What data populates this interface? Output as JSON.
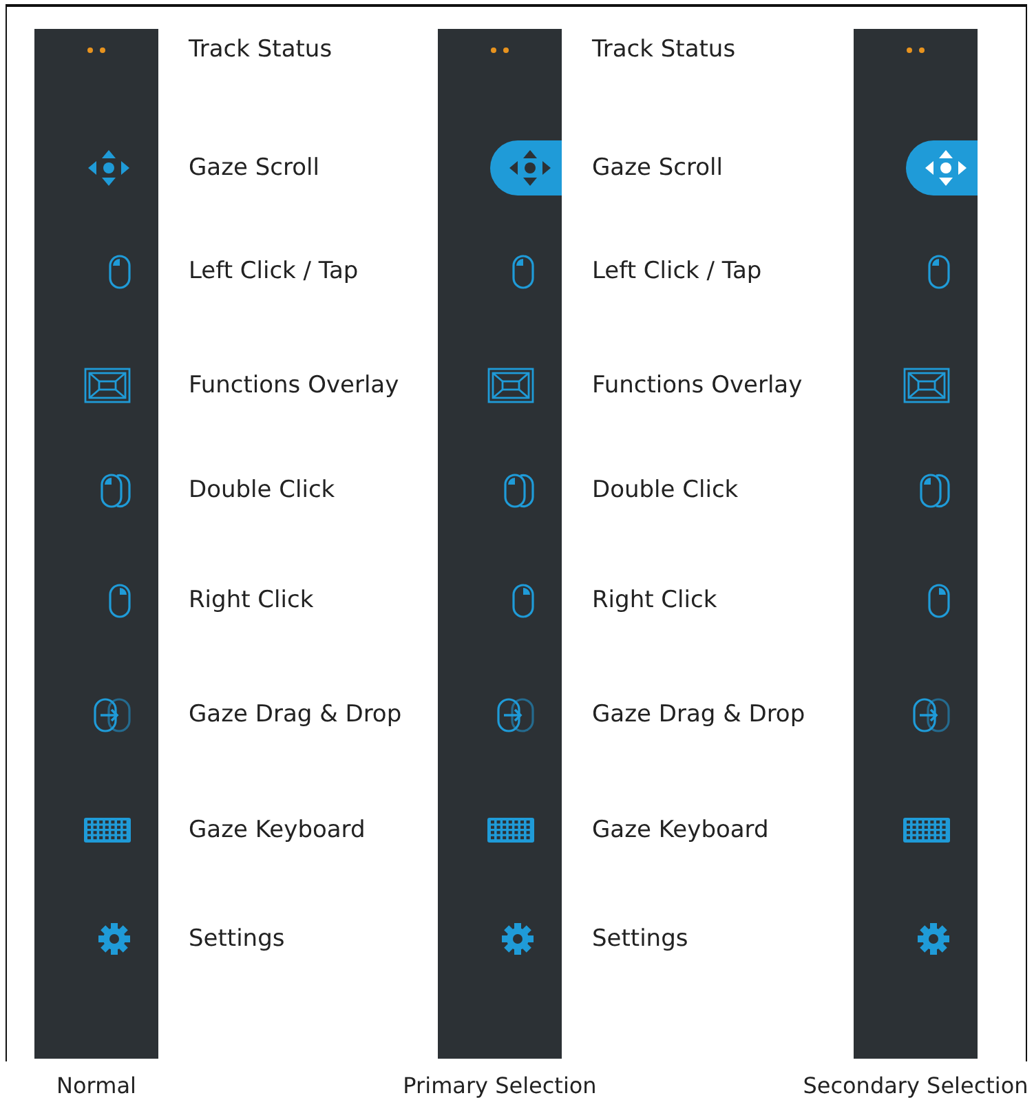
{
  "panels": [
    {
      "caption": "Normal",
      "items": [
        {
          "label": "Track Status",
          "selected": false
        },
        {
          "label": "Gaze Scroll",
          "selected": false
        },
        {
          "label": "Left Click / Tap",
          "selected": false
        },
        {
          "label": "Functions Overlay",
          "selected": false
        },
        {
          "label": "Double Click",
          "selected": false
        },
        {
          "label": "Right Click",
          "selected": false
        },
        {
          "label": "Gaze Drag & Drop",
          "selected": false
        },
        {
          "label": "Gaze Keyboard",
          "selected": false
        },
        {
          "label": "Settings",
          "selected": false
        }
      ]
    },
    {
      "caption": "Primary Selection",
      "kind": "primary",
      "items": [
        {
          "label": "Track Status",
          "selected": false
        },
        {
          "label": "Gaze Scroll",
          "selected": true
        },
        {
          "label": "Left Click / Tap",
          "selected": false
        },
        {
          "label": "Functions Overlay",
          "selected": false
        },
        {
          "label": "Double Click",
          "selected": false
        },
        {
          "label": "Right Click",
          "selected": false
        },
        {
          "label": "Gaze Drag & Drop",
          "selected": false
        },
        {
          "label": "Gaze Keyboard",
          "selected": false
        },
        {
          "label": "Settings",
          "selected": false
        }
      ]
    },
    {
      "caption": "Secondary Selection",
      "kind": "secondary",
      "items": [
        {
          "selected": false
        },
        {
          "selected": true
        },
        {
          "selected": false
        },
        {
          "selected": false
        },
        {
          "selected": false
        },
        {
          "selected": false
        },
        {
          "selected": false
        },
        {
          "selected": false
        },
        {
          "selected": false
        }
      ]
    }
  ]
}
